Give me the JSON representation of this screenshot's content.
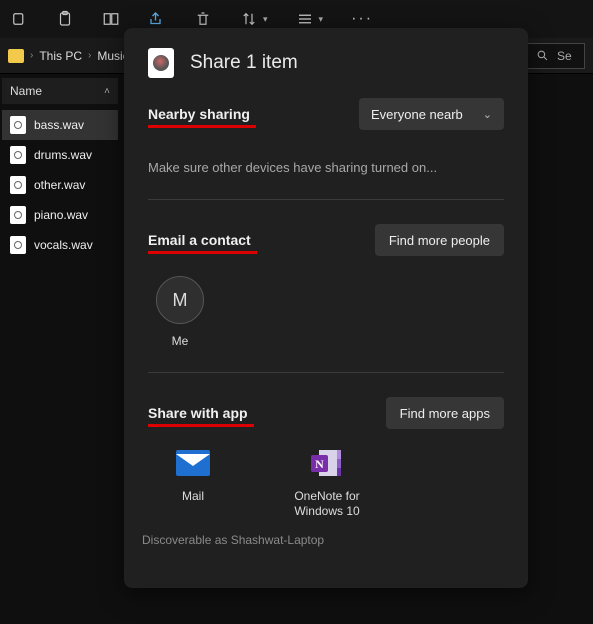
{
  "toolbar": {
    "items": [
      "copy",
      "paste",
      "layout-copy",
      "share",
      "delete",
      "sort",
      "view",
      "more"
    ]
  },
  "breadcrumb": {
    "p1": "This PC",
    "p2": "Music"
  },
  "search": {
    "placeholder": "Se"
  },
  "filelist": {
    "column": "Name",
    "files": [
      "bass.wav",
      "drums.wav",
      "other.wav",
      "piano.wav",
      "vocals.wav"
    ],
    "selected_index": 0
  },
  "share": {
    "title": "Share 1 item",
    "nearby": {
      "heading": "Nearby sharing",
      "scope": "Everyone nearb",
      "hint": "Make sure other devices have sharing turned on..."
    },
    "email": {
      "heading": "Email a contact",
      "find_button": "Find more people",
      "contacts": [
        {
          "initial": "M",
          "name": "Me"
        }
      ]
    },
    "apps": {
      "heading": "Share with app",
      "find_button": "Find more apps",
      "list": [
        {
          "name": "Mail",
          "icon": "mail"
        },
        {
          "name": "OneNote for Windows 10",
          "icon": "onenote"
        }
      ]
    },
    "footer": "Discoverable as Shashwat-Laptop"
  }
}
